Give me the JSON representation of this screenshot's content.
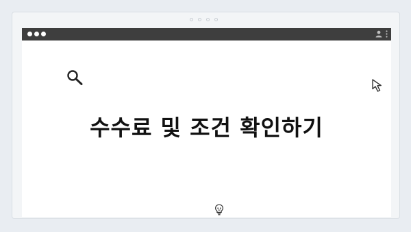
{
  "page": {
    "headline": "수수료 및 조건 확인하기"
  },
  "icons": {
    "top_dots": "carousel-dots",
    "window_controls": "three-dot-window-controls",
    "user": "user-icon",
    "menu": "kebab-menu-icon",
    "search": "search-icon",
    "cursor": "cursor-arrow-icon",
    "bulb": "lightbulb-icon"
  },
  "colors": {
    "background": "#e9edf2",
    "titlebar": "#3e3e3e",
    "content": "#ffffff",
    "text": "#111111"
  }
}
